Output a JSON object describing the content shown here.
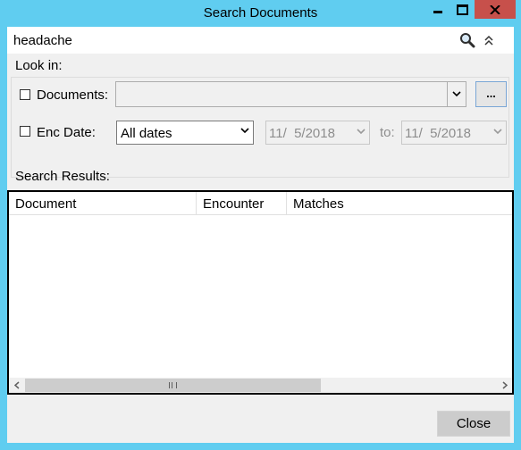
{
  "window": {
    "title": "Search Documents"
  },
  "search": {
    "value": "headache"
  },
  "look_in": {
    "label": "Look in:",
    "documents": {
      "label": "Documents:",
      "checked": false,
      "value": "",
      "browse_label": "..."
    },
    "enc_date": {
      "label": "Enc Date:",
      "checked": false,
      "range_value": "All dates",
      "from_date": "11/  5/2018",
      "to_label": "to:",
      "to_date": "11/  5/2018"
    }
  },
  "results": {
    "label": "Search Results:",
    "columns": [
      "Document",
      "Encounter",
      "Matches"
    ],
    "rows": []
  },
  "footer": {
    "close_label": "Close"
  },
  "colors": {
    "titlebar": "#60cdf0",
    "close_button": "#c7504b",
    "dialog_bg": "#f0f0f0"
  }
}
